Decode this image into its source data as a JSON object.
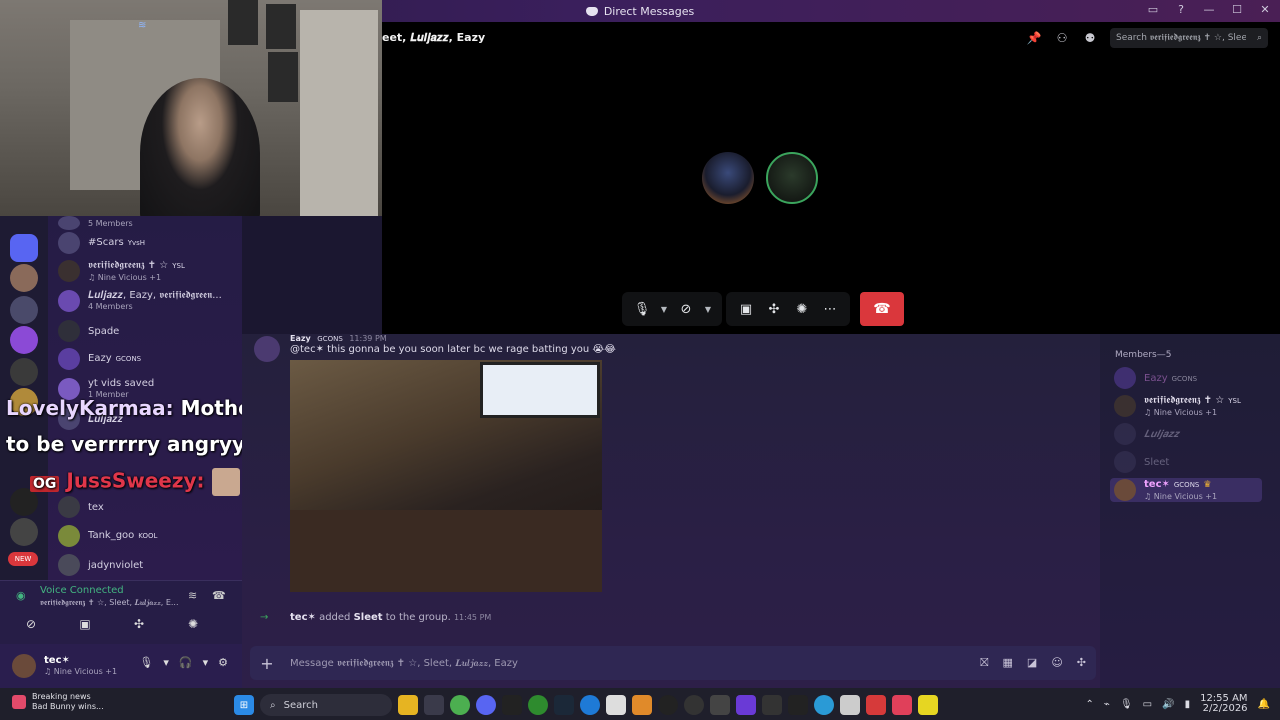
{
  "window": {
    "title": "Direct Messages",
    "controls": [
      "▭",
      "?",
      "—",
      "☐",
      "✕"
    ]
  },
  "call": {
    "dm_name": "Sleet, 𝑳𝒖𝒍𝒋𝒂𝒛𝒛, Eazy",
    "dm_name_shown": "eet, 𝑳𝒖𝒍𝒋𝒂𝒛𝒛, Eazy",
    "search_placeholder": "Search 𝖛𝖊𝖗𝖎𝖋𝖎𝖊𝖉𝖌𝖗𝖊𝖊𝖓𝖟 ✝ ☆, Slee..."
  },
  "sidebar": {
    "dms": [
      {
        "name": "",
        "sub": "5 Members"
      },
      {
        "name": "#Scars",
        "badge": "YvsH",
        "sub": ""
      },
      {
        "name": "𝖛𝖊𝖗𝖎𝖋𝖎𝖊𝖉𝖌𝖗𝖊𝖊𝖓𝖟 ✝ ☆",
        "badge": "YSL",
        "sub": "♫ Nine Vicious +1"
      },
      {
        "name": "𝑳𝒖𝒍𝒋𝒂𝒛𝒛, Eazy, 𝖛𝖊𝖗𝖎𝖋𝖎𝖊𝖉𝖌𝖗𝖊𝖊𝖓...",
        "badge": "",
        "sub": "4 Members"
      },
      {
        "name": "Spade",
        "badge": "",
        "sub": ""
      },
      {
        "name": "Eazy",
        "badge": "GCONS",
        "sub": ""
      },
      {
        "name": "yt vids saved",
        "badge": "",
        "sub": "1 Member"
      },
      {
        "name": "𝑳𝒖𝒍𝒋𝒂𝒛𝒛",
        "badge": "",
        "sub": ""
      },
      {
        "name": "tex",
        "badge": "",
        "sub": ""
      },
      {
        "name": "Tank_goo",
        "badge": "KOOL",
        "sub": ""
      },
      {
        "name": "jadynviolet",
        "badge": "",
        "sub": ""
      }
    ],
    "voice": {
      "title": "Voice Connected",
      "sub": "𝖛𝖊𝖗𝖎𝖋𝖎𝖊𝖉𝖌𝖗𝖊𝖊𝖓𝖟 ✝ ☆, Sleet, 𝑳𝒖𝒍𝒋𝒂𝒛𝒛, E..."
    },
    "user": {
      "name": "tec✶",
      "sub": "♫ Nine Vicious +1"
    }
  },
  "overlay": {
    "line1_user": "LovelyKarmaa:",
    "line1_text": "Mother is going",
    "line2_text": "to be verrrrry angryyy",
    "line3_user": "JussSweezy:",
    "line3_badge": "OG"
  },
  "chat": {
    "message": {
      "author": "Eazy",
      "badge": "GCONS",
      "time": "11:39 PM",
      "text": "@tec✶  this gonna be you soon later bc we rage batting you 😭😂"
    },
    "system": {
      "actor": "tec✶",
      "action": "added",
      "target": "Sleet",
      "rest": "to the group.",
      "time": "11:45 PM"
    },
    "composer_placeholder": "Message 𝖛𝖊𝖗𝖎𝖋𝖎𝖊𝖉𝖌𝖗𝖊𝖊𝖓𝖟 ✝ ☆, Sleet, 𝑳𝒖𝒍𝒋𝒂𝒛𝒛, Eazy"
  },
  "members": {
    "heading": "Members—5",
    "list": [
      {
        "name": "Eazy",
        "badge": "GCONS",
        "sub": "",
        "color": "#c57bd6"
      },
      {
        "name": "𝖛𝖊𝖗𝖎𝖋𝖎𝖊𝖉𝖌𝖗𝖊𝖊𝖓𝖟 ✝ ☆",
        "badge": "YSL",
        "sub": "♫ Nine Vicious +1",
        "color": "#e6e2f0"
      },
      {
        "name": "𝑳𝒖𝒍𝒋𝒂𝒛𝒛",
        "badge": "",
        "sub": "",
        "color": "#b8b3cc"
      },
      {
        "name": "Sleet",
        "badge": "",
        "sub": "",
        "color": "#b8b3cc"
      },
      {
        "name": "tec✶",
        "badge": "GCONS",
        "sub": "♫ Nine Vicious +1",
        "color": "#f0a3ff"
      }
    ]
  },
  "taskbar": {
    "news_title": "Breaking news",
    "news_sub": "Bad Bunny wins...",
    "search": "Search",
    "time": "12:55 AM",
    "date": "2/2/2026"
  },
  "colors": {
    "hangup": "#da373c",
    "voice_connected": "#43b581",
    "accent_purple": "#5b3aa0"
  }
}
